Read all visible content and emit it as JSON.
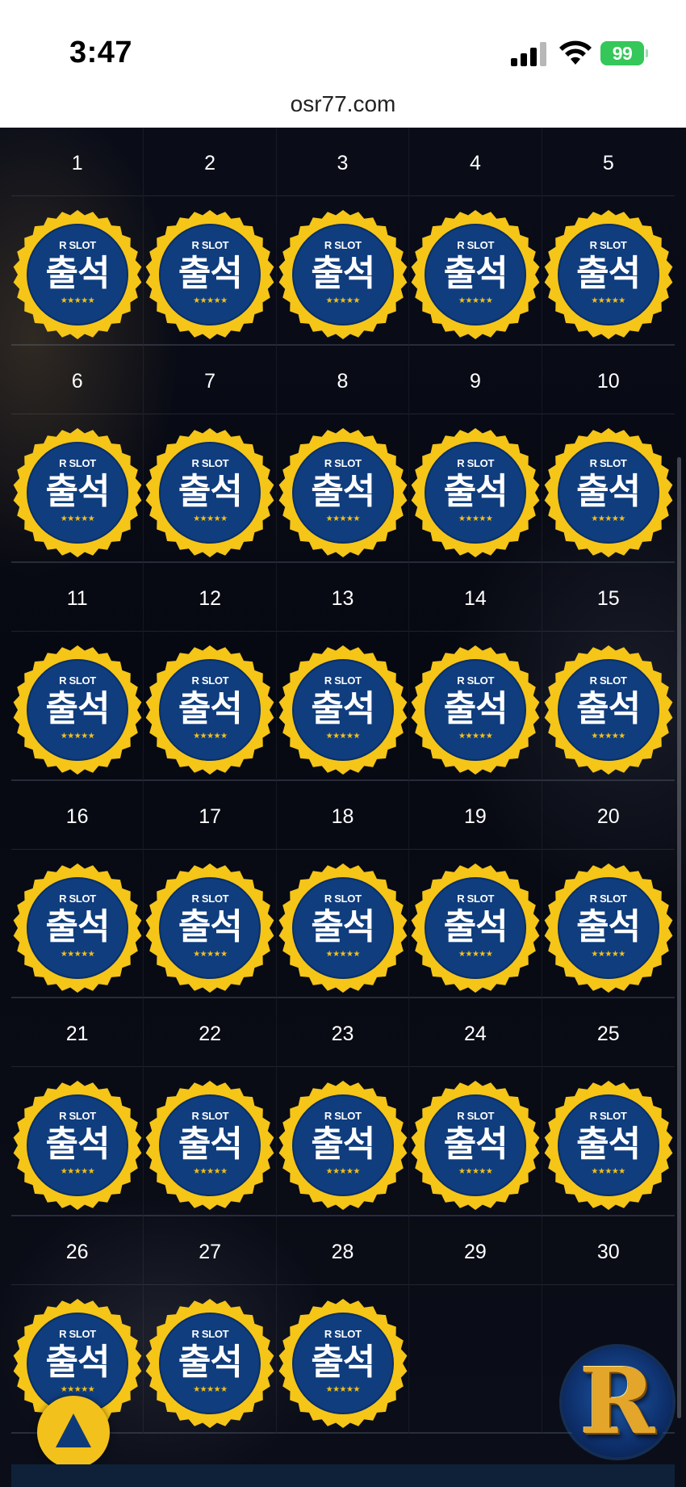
{
  "status_bar": {
    "time": "3:47",
    "battery": "99",
    "battery_color": "#34c759"
  },
  "browser": {
    "url": "osr77.com"
  },
  "calendar": {
    "days": [
      "1",
      "2",
      "3",
      "4",
      "5",
      "6",
      "7",
      "8",
      "9",
      "10",
      "11",
      "12",
      "13",
      "14",
      "15",
      "16",
      "17",
      "18",
      "19",
      "20",
      "21",
      "22",
      "23",
      "24",
      "25",
      "26",
      "27",
      "28",
      "29",
      "30"
    ],
    "stamped_through": 28,
    "stamp": {
      "brand": "R SLOT",
      "title": "출석",
      "stars": "★★★★★",
      "ring_color": "#f5c518",
      "fill_color": "#0f3d7e"
    }
  },
  "floating": {
    "scroll_top_icon": "up-triangle-icon",
    "logo_letter": "R"
  }
}
